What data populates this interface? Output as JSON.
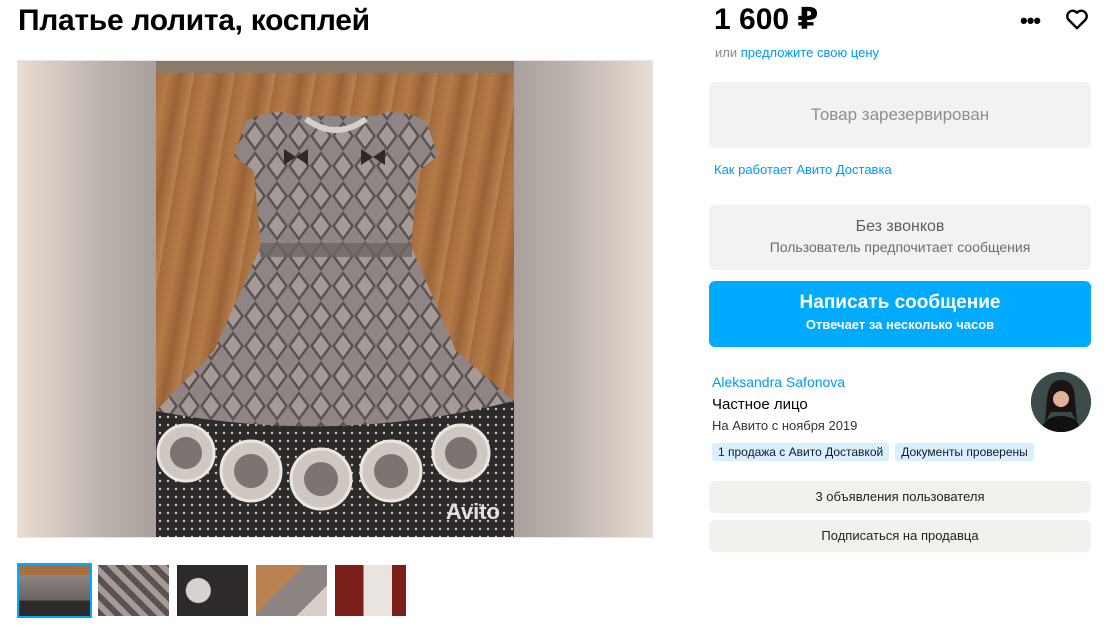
{
  "listing": {
    "title": "Платье лолита, косплей",
    "price": "1 600 ₽",
    "offer_prefix": "или",
    "offer_link": "предложите свою цену",
    "watermark": "Avito"
  },
  "actions": {
    "reserved_label": "Товар зарезервирован",
    "delivery_link": "Как работает Авито Доставка",
    "no_calls_title": "Без звонков",
    "no_calls_subtitle": "Пользователь предпочитает сообщения",
    "message_button": "Написать сообщение",
    "message_subtitle": "Отвечает за несколько часов"
  },
  "seller": {
    "name": "Aleksandra Safonova",
    "type": "Частное лицо",
    "since": "На Авито с ноября 2019",
    "badges": [
      "1 продажа с Авито Доставкой",
      "Документы проверены"
    ],
    "ads_button": "3 объявления пользователя",
    "subscribe_button": "Подписаться на продавца"
  },
  "icons": {
    "more": "more-icon",
    "favorite": "heart-icon"
  },
  "colors": {
    "accent": "#00aaff",
    "link": "#0099f7",
    "badge_bg": "#d7efff"
  }
}
